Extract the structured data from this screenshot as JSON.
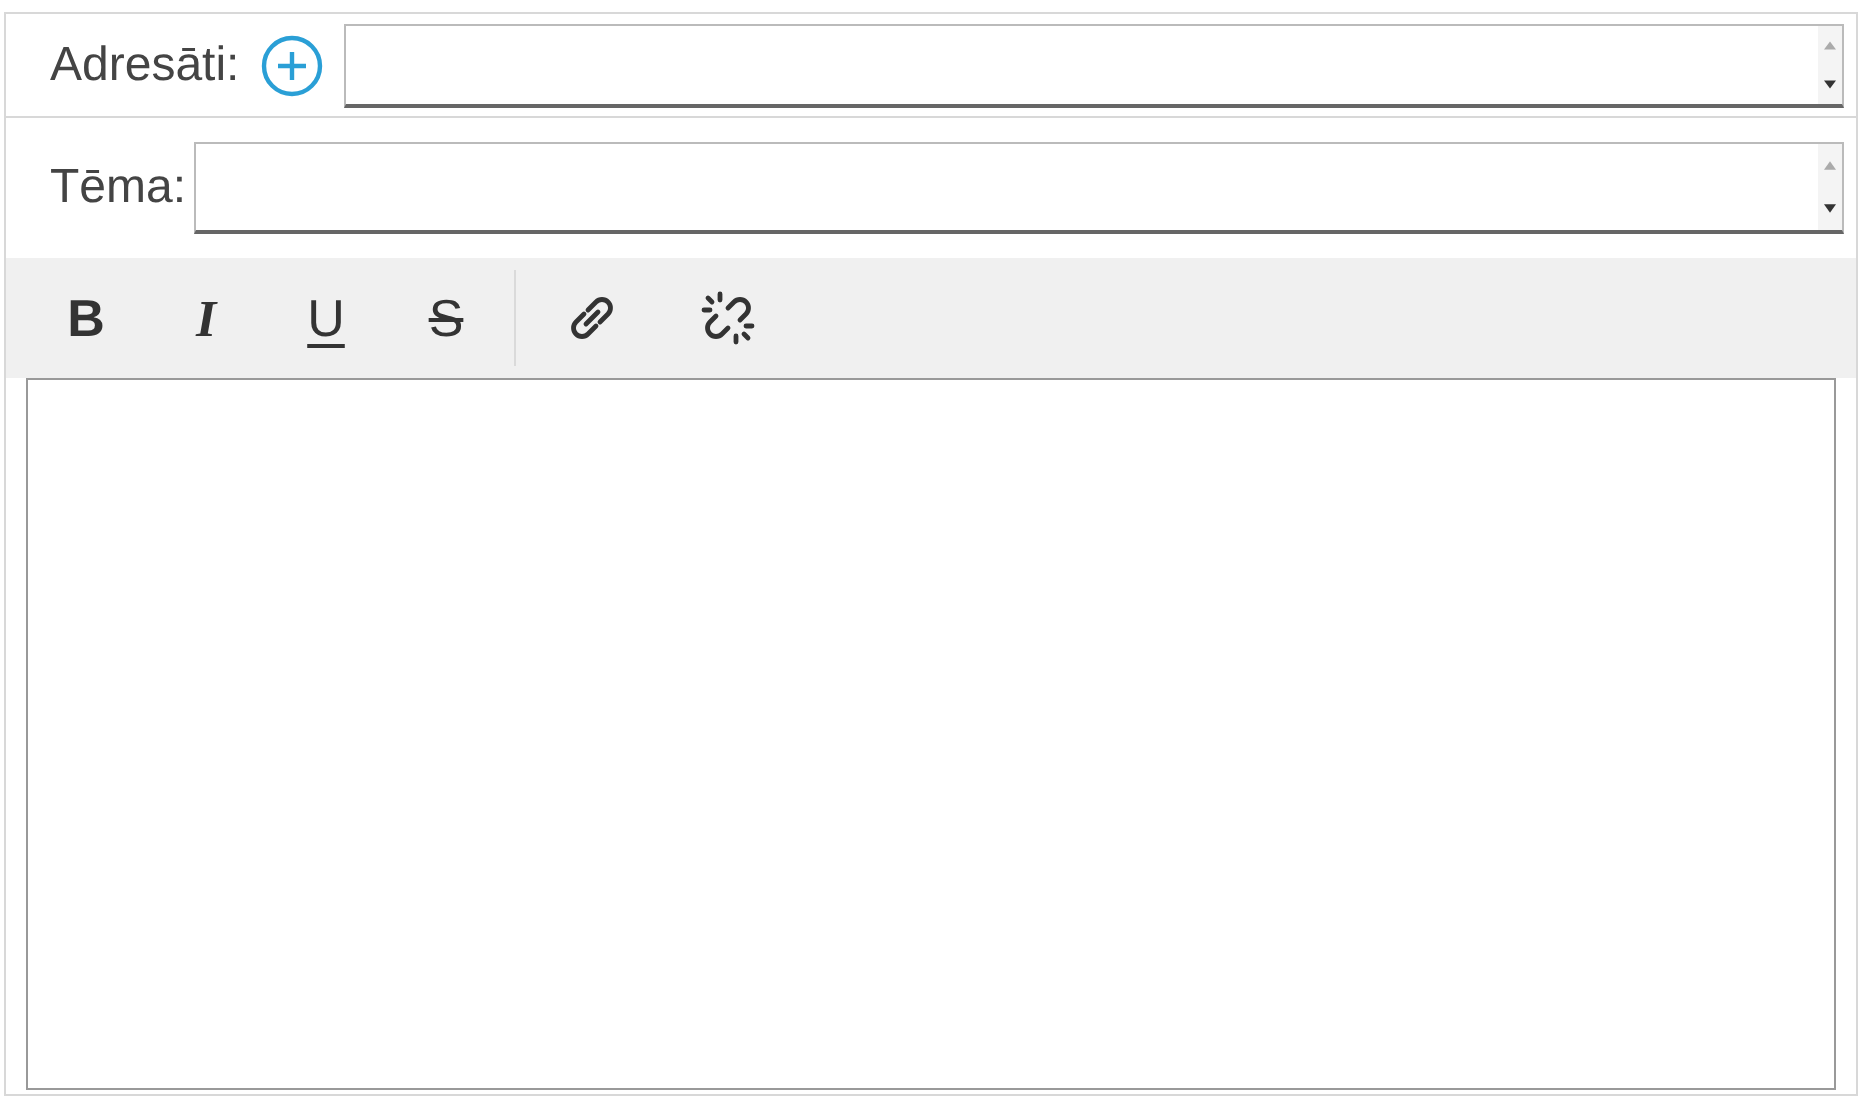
{
  "recipients": {
    "label": "Adresāti:"
  },
  "subject": {
    "label": "Tēma:"
  },
  "toolbar": [
    {
      "kind": "bold",
      "label": "B"
    },
    {
      "kind": "italic",
      "label": "I"
    },
    {
      "kind": "underline",
      "label": "U"
    },
    {
      "kind": "strike",
      "label": "S"
    },
    {
      "kind": "separator"
    },
    {
      "kind": "link"
    },
    {
      "kind": "unlink"
    }
  ]
}
